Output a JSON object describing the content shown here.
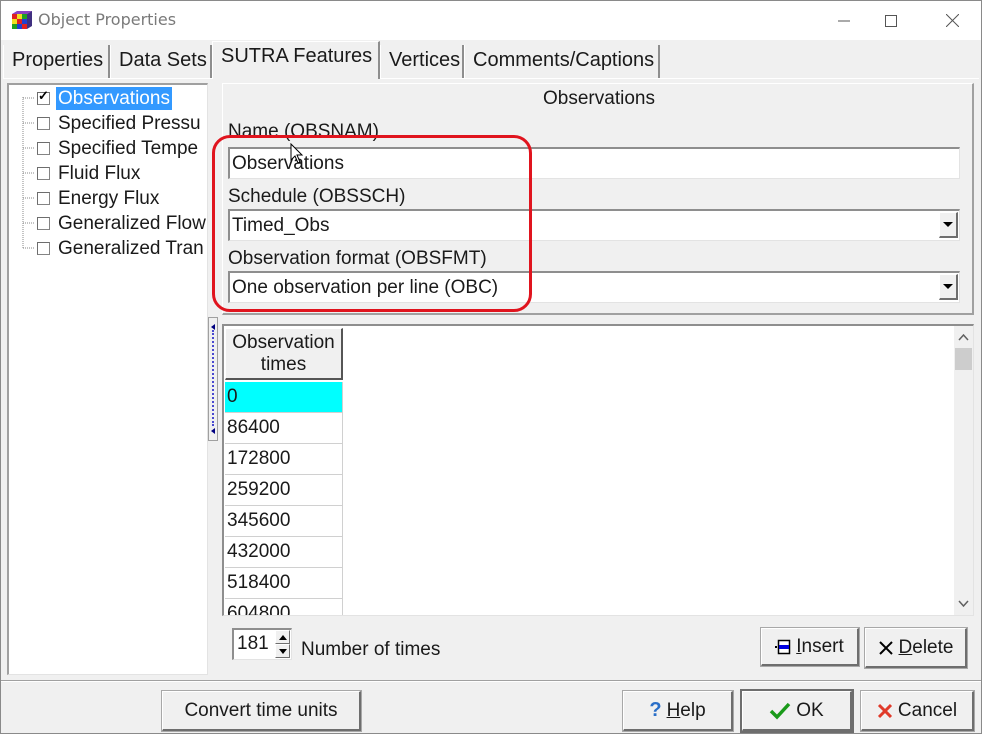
{
  "window": {
    "title": "Object Properties",
    "icon": "app-cube-icon",
    "controls": {
      "minimize": "minimize-icon",
      "maximize": "maximize-icon",
      "close": "close-icon"
    }
  },
  "tabs": [
    {
      "label": "Properties",
      "active": false
    },
    {
      "label": "Data Sets",
      "active": false
    },
    {
      "label": "SUTRA Features",
      "active": true
    },
    {
      "label": "Vertices",
      "active": false
    },
    {
      "label": "Comments/Captions",
      "active": false
    }
  ],
  "tree": {
    "items": [
      {
        "label": "Observations",
        "checked": true,
        "selected": true
      },
      {
        "label": "Specified Pressu",
        "checked": false,
        "selected": false
      },
      {
        "label": "Specified Tempe",
        "checked": false,
        "selected": false
      },
      {
        "label": "Fluid Flux",
        "checked": false,
        "selected": false
      },
      {
        "label": "Energy Flux",
        "checked": false,
        "selected": false
      },
      {
        "label": "Generalized Flow",
        "checked": false,
        "selected": false
      },
      {
        "label": "Generalized Tran",
        "checked": false,
        "selected": false
      }
    ]
  },
  "panel": {
    "title": "Observations",
    "name_label": "Name (OBSNAM)",
    "name_value": "Observations",
    "schedule_label": "Schedule (OBSSCH)",
    "schedule_value": "Timed_Obs",
    "format_label": "Observation format (OBSFMT)",
    "format_value": "One observation per line (OBC)"
  },
  "grid": {
    "header_line1": "Observation",
    "header_line2": "times",
    "rows": [
      "0",
      "86400",
      "172800",
      "259200",
      "345600",
      "432000",
      "518400",
      "604800"
    ],
    "selected_index": 0
  },
  "count": {
    "value": "181",
    "label": "Number of times"
  },
  "buttons": {
    "insert": {
      "prefix": "",
      "mnemonic": "I",
      "rest": "nsert"
    },
    "delete": {
      "mnemonic": "D",
      "rest": "elete"
    },
    "convert": "Convert time units",
    "help": {
      "mnemonic": "H",
      "rest": "elp"
    },
    "ok": "OK",
    "cancel": "Cancel"
  },
  "colors": {
    "selection": "#3399ff",
    "grid_selected_cell": "#00ffff",
    "annotation_red": "#e0141e",
    "ok_green": "#1a9a1a",
    "cancel_red": "#e03a2a",
    "help_blue": "#2a6fc8"
  }
}
